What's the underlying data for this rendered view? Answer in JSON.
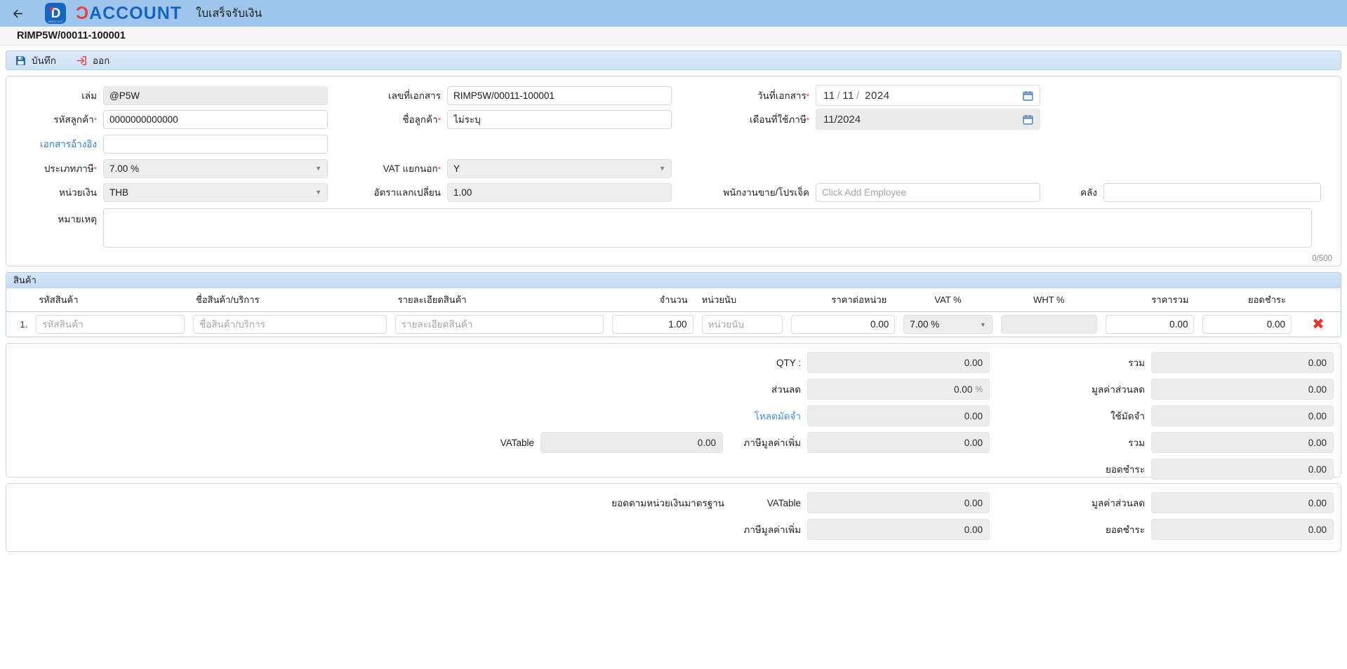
{
  "appbar": {
    "back_icon": "arrow-left-icon",
    "logo_mark": "D",
    "logo_sub": "ABSOLUTE",
    "brand_part1": "Ɔ",
    "brand_part2": "ACCOUNT",
    "doc_type": "ใบเสร็จรับเงิน"
  },
  "doc_number": "RIMP5W/00011-100001",
  "toolbar": {
    "save_label": "บันทึก",
    "save_icon": "floppy-save-icon",
    "exit_label": "ออก",
    "exit_icon": "exit-arrow-icon"
  },
  "form": {
    "book_label": "เล่ม",
    "book_value": "@P5W",
    "docno_label": "เลขที่เอกสาร",
    "docno_value": "RIMP5W/00011-100001",
    "docdate_label": "วันที่เอกสาร",
    "docdate_day": "11",
    "docdate_month": "11",
    "docdate_year": "2024",
    "custcode_label": "รหัสลูกค้า",
    "custcode_value": "0000000000000",
    "custname_label": "ชื่อลูกค้า",
    "custname_value": "ไม่ระบุ",
    "taxmonth_label": "เดือนที่ใช้ภาษี",
    "taxmonth_value": "11/2024",
    "refdoc_label": "เอกสารอ้างอิง",
    "refdoc_value": "",
    "taxtype_label": "ประเภทภาษี",
    "taxtype_value": "7.00 %",
    "vatsep_label": "VAT แยกนอก",
    "vatsep_value": "Y",
    "currency_label": "หน่วยเงิน",
    "currency_value": "THB",
    "exrate_label": "อัตราแลกเปลี่ยน",
    "exrate_value": "1.00",
    "employee_label": "พนักงานขาย/โปรเจ็ค",
    "employee_placeholder": "Click Add Employee",
    "employee_value": "",
    "warehouse_label": "คลัง",
    "warehouse_value": "",
    "note_label": "หมายเหตุ",
    "note_value": "",
    "note_counter": "0/500",
    "calendar_icon": "calendar-icon",
    "required_mark": "*"
  },
  "items": {
    "section_title": "สินค้า",
    "columns": [
      "รหัสสินค้า",
      "ชื่อสินค้า/บริการ",
      "รายละเอียดสินค้า",
      "จำนวน",
      "หน่วยนับ",
      "ราคาต่อหน่วย",
      "VAT %",
      "WHT %",
      "ราคารวม",
      "ยอดชำระ"
    ],
    "rows": [
      {
        "index": "1.",
        "code": "",
        "code_placeholder": "รหัสสินค้า",
        "name": "",
        "name_placeholder": "ชื่อสินค้า/บริการ",
        "detail": "",
        "detail_placeholder": "รายละเอียดสินค้า",
        "qty": "1.00",
        "unit": "",
        "unit_placeholder": "หน่วยนับ",
        "price": "0.00",
        "vat": "7.00 %",
        "wht": "",
        "total": "0.00",
        "paid": "0.00",
        "delete_icon": "close-x-icon"
      }
    ]
  },
  "totals": {
    "qty_label": "QTY :",
    "qty_value": "0.00",
    "sum_label": "รวม",
    "sum_value": "0.00",
    "discount_label": "ส่วนลด",
    "discount_value": "0.00",
    "discount_unit": "%",
    "discount_amt_label": "มูลค่าส่วนลด",
    "discount_amt_value": "0.00",
    "deposit_link_label": "โหลดมัดจำ",
    "deposit_value": "0.00",
    "use_deposit_label": "ใช้มัดจำ",
    "use_deposit_value": "0.00",
    "vatable_label": "VATable",
    "vatable_value": "0.00",
    "vat_label": "ภาษีมูลค่าเพิ่ม",
    "vat_value": "0.00",
    "sum2_label": "รวม",
    "sum2_value": "0.00",
    "netpay_label": "ยอดชำระ",
    "netpay_value": "0.00"
  },
  "standard": {
    "section_label": "ยอดตามหน่วยเงินมาตรฐาน",
    "vatable_label": "VATable",
    "vatable_value": "0.00",
    "discount_amt_label": "มูลค่าส่วนลด",
    "discount_amt_value": "0.00",
    "vat_label": "ภาษีมูลค่าเพิ่ม",
    "vat_value": "0.00",
    "netpay_label": "ยอดชำระ",
    "netpay_value": "0.00"
  },
  "colors": {
    "appbar_bg": "#9ec6ec",
    "brand_red": "#e8413c",
    "brand_blue": "#1565c0",
    "link_blue": "#2f80d8",
    "required_red": "#e53935",
    "delete_red": "#e8332b"
  }
}
